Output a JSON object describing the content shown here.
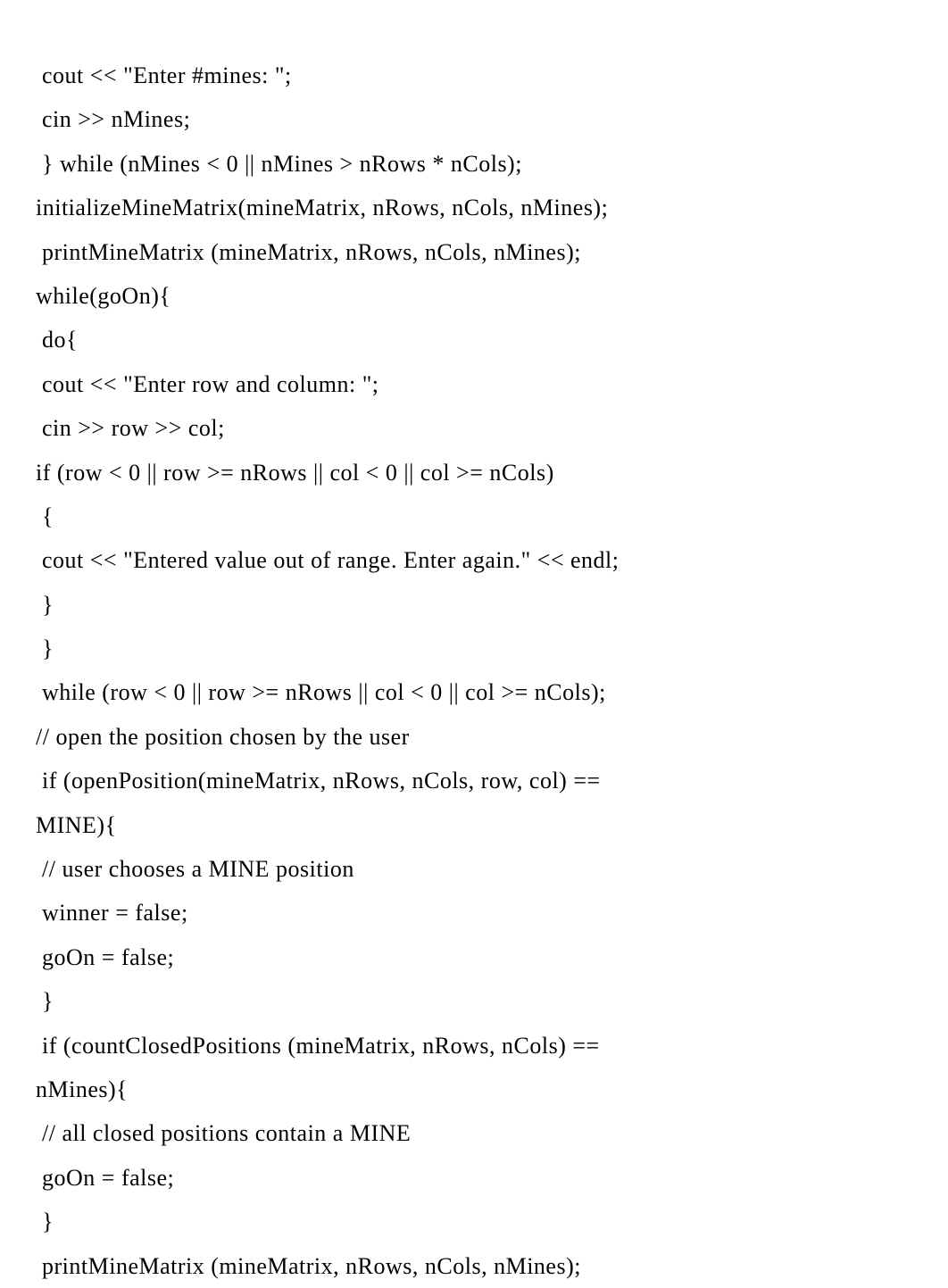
{
  "lines": [
    " cout << \"Enter #mines: \";",
    " cin >> nMines;",
    " } while (nMines < 0 || nMines > nRows * nCols);",
    "initializeMineMatrix(mineMatrix, nRows, nCols, nMines);",
    " printMineMatrix (mineMatrix, nRows, nCols, nMines);",
    "while(goOn){",
    " do{",
    " cout << \"Enter row and column: \";",
    " cin >> row >> col;",
    "if (row < 0 || row >= nRows || col < 0 || col >= nCols)",
    " {",
    " cout << \"Entered value out of range. Enter again.\" << endl;",
    " }",
    " }",
    " while (row < 0 || row >= nRows || col < 0 || col >= nCols);",
    "// open the position chosen by the user",
    " if (openPosition(mineMatrix, nRows, nCols, row, col) ==",
    "MINE){",
    " // user chooses a MINE position",
    " winner = false;",
    " goOn = false;",
    " }",
    " if (countClosedPositions (mineMatrix, nRows, nCols) ==",
    "nMines){",
    " // all closed positions contain a MINE",
    " goOn = false;",
    " }",
    " printMineMatrix (mineMatrix, nRows, nCols, nMines);"
  ]
}
